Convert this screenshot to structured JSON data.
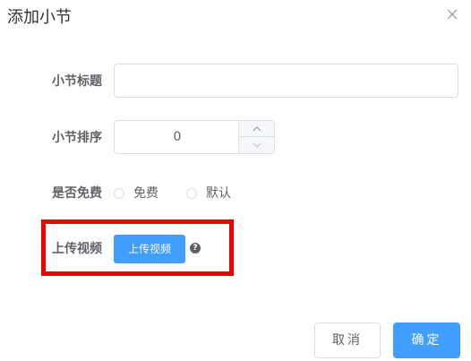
{
  "dialog": {
    "title": "添加小节",
    "close_icon": "close-icon"
  },
  "form": {
    "title_label": "小节标题",
    "title_value": "",
    "sort_label": "小节排序",
    "sort_value": "0",
    "free_label": "是否免费",
    "free_options": [
      "免费",
      "默认"
    ],
    "upload_label": "上传视频",
    "upload_button": "上传视频",
    "help_icon": "question-circle-icon",
    "help_glyph": "?"
  },
  "footer": {
    "cancel_label": "取消",
    "confirm_label": "确定"
  },
  "colors": {
    "primary": "#409eff",
    "highlight": "#ee0000",
    "border": "#dcdfe6"
  }
}
